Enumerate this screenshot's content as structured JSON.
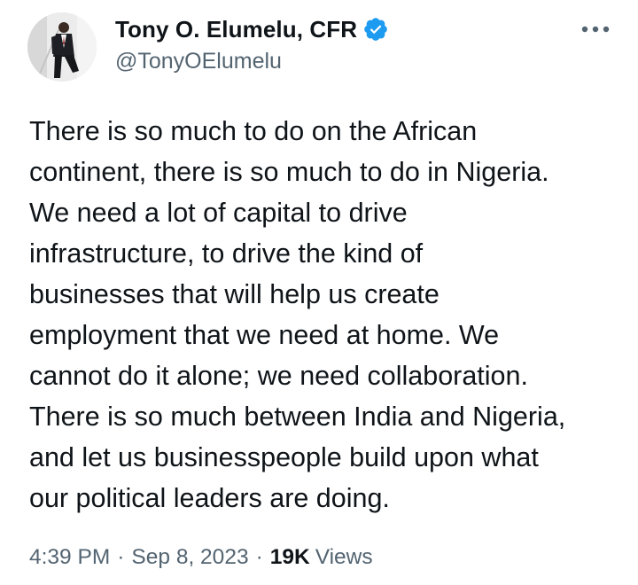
{
  "author": {
    "name": "Tony O. Elumelu, CFR",
    "handle": "@TonyOElumelu",
    "verified_badge_color": "#1d9bf0",
    "avatar_icon": "profile-photo"
  },
  "more_icon": "more-horizontal-icon",
  "tweet": {
    "text": "There is so much to do on the African\ncontinent, there is so much to do in Nigeria.\nWe need a lot of capital to drive\ninfrastructure, to drive the kind of\nbusinesses that will help us create\nemployment that we need at home. We\ncannot do it alone; we need collaboration.\nThere is so much between India and Nigeria,\nand let us businesspeople build upon what\nour political leaders are doing."
  },
  "meta": {
    "time": "4:39 PM",
    "separator": "·",
    "date": "Sep 8, 2023",
    "views_count": "19K",
    "views_label": "Views"
  },
  "colors": {
    "text_primary": "#0f1419",
    "text_secondary": "#536471",
    "accent": "#1d9bf0",
    "background": "#ffffff"
  }
}
